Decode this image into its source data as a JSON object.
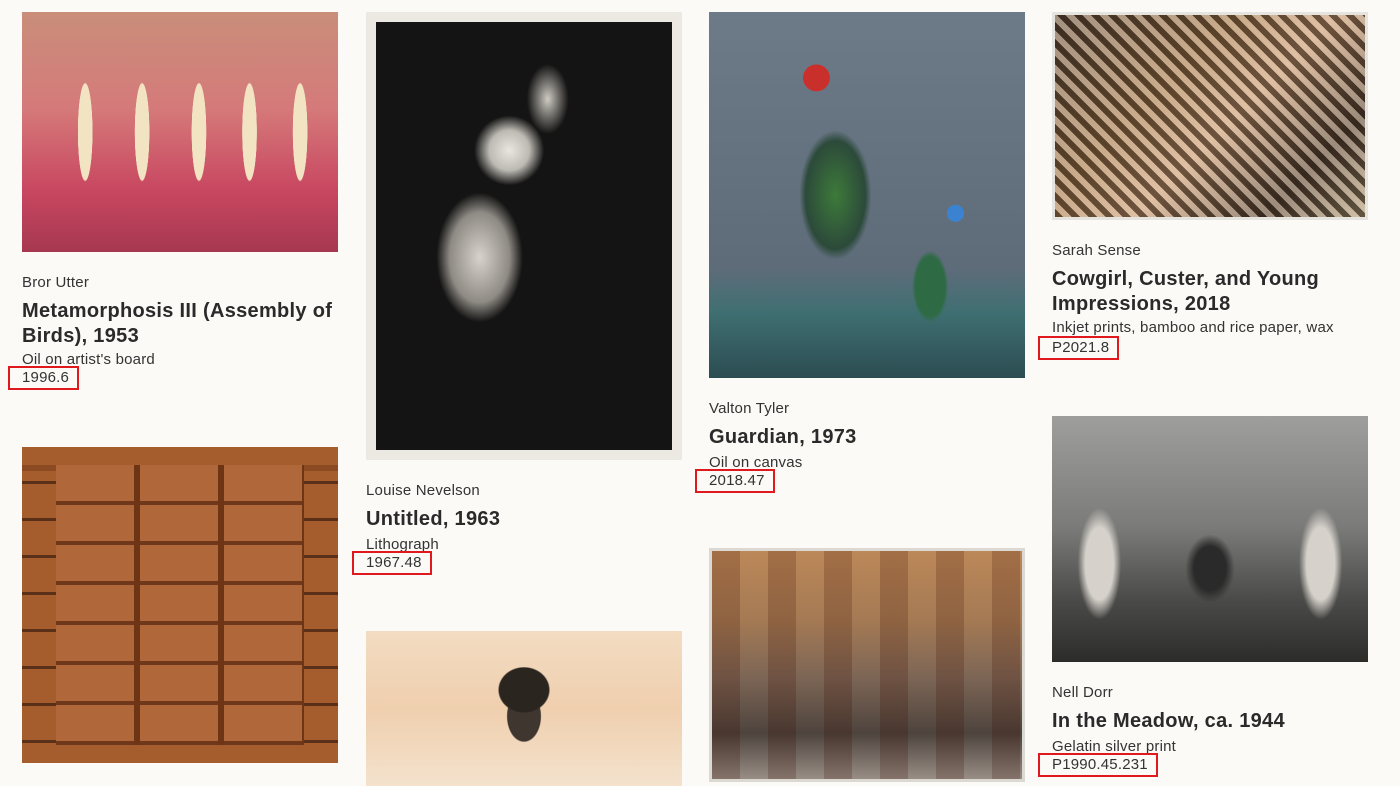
{
  "cards": [
    {
      "id": "utter",
      "image_alt": "Metamorphosis III (Assembly of Birds) artwork",
      "artist": "Bror Utter",
      "title": "Metamorphosis III (Assembly of Birds), 1953",
      "medium": "Oil on artist's board",
      "accession": "1996.6"
    },
    {
      "id": "nevelson",
      "image_alt": "Untitled lithograph artwork",
      "artist": "Louise Nevelson",
      "title": "Untitled, 1963",
      "medium": "Lithograph",
      "accession": "1967.48"
    },
    {
      "id": "tyler",
      "image_alt": "Guardian painting",
      "artist": "Valton Tyler",
      "title": "Guardian, 1973",
      "medium": "Oil on canvas",
      "accession": "2018.47"
    },
    {
      "id": "sense",
      "image_alt": "Cowgirl, Custer, and Young Impressions artwork",
      "artist": "Sarah Sense",
      "title": "Cowgirl, Custer, and Young Impressions, 2018",
      "medium": "Inkjet prints, bamboo and rice paper, wax",
      "accession": "P2021.8"
    },
    {
      "id": "dorr",
      "image_alt": "In the Meadow photograph",
      "artist": "Nell Dorr",
      "title": "In the Meadow, ca. 1944",
      "medium": "Gelatin silver print",
      "accession": "P1990.45.231"
    }
  ],
  "partial_images": [
    {
      "id": "cabinet",
      "image_alt": "Wooden display cabinet"
    },
    {
      "id": "portrait",
      "image_alt": "Portrait drawing of a woman"
    },
    {
      "id": "sunkist",
      "image_alt": "Mixed media artwork on Sunkist crates"
    }
  ],
  "colors": {
    "background": "#fbfaf7",
    "highlight_box": "#e0191f",
    "text": "#2a2a2a"
  }
}
